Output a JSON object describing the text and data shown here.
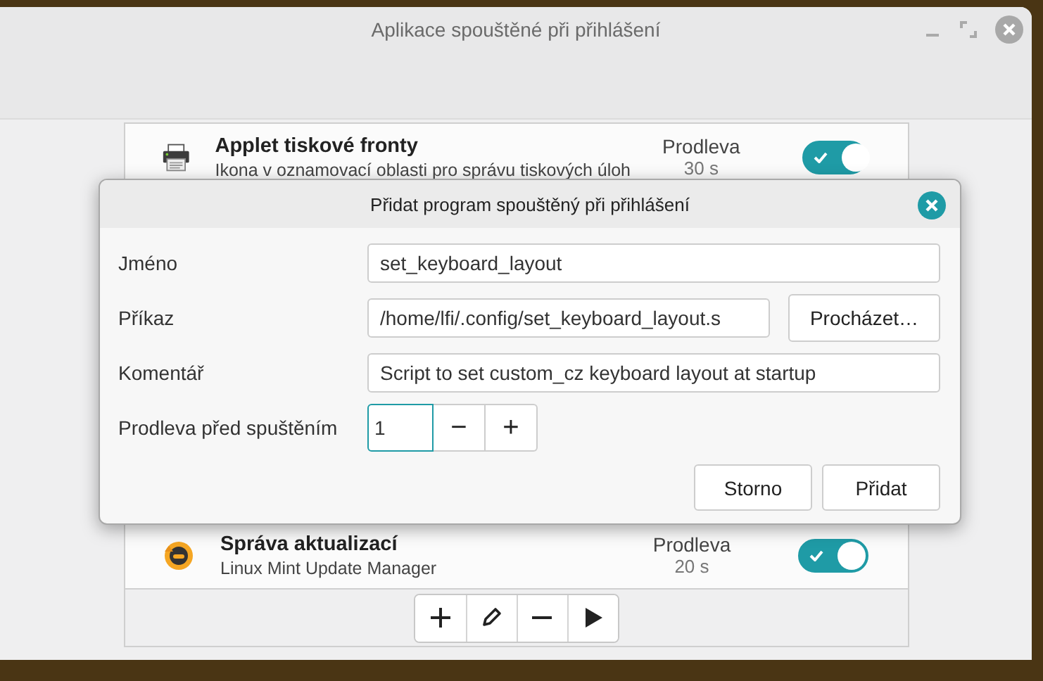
{
  "window": {
    "title": "Aplikace spouštěné při přihlášení"
  },
  "startup_list": [
    {
      "kind": "printer",
      "title": "Applet tiskové fronty",
      "subtitle": "Ikona v oznamovací oblasti pro správu tiskových úloh",
      "delay_label": "Prodleva",
      "delay": "30 s",
      "enabled": true
    },
    {
      "kind": "update",
      "title": "Správa aktualizací",
      "subtitle": "Linux Mint Update Manager",
      "delay_label": "Prodleva",
      "delay": "20 s",
      "enabled": true
    }
  ],
  "toolbar": [
    {
      "kind": "add"
    },
    {
      "kind": "edit"
    },
    {
      "kind": "remove"
    },
    {
      "kind": "run"
    }
  ],
  "dialog": {
    "title": "Přidat program spouštěný při přihlášení",
    "fields": [
      {
        "label": "Jméno",
        "value": "set_keyboard_layout"
      },
      {
        "label": "Příkaz",
        "value": "/home/lfi/.config/set_keyboard_layout.s",
        "button": "Procházet…"
      },
      {
        "label": "Komentář",
        "value": "Script to set custom_cz keyboard layout at startup"
      }
    ],
    "delay": {
      "label": "Prodleva před spuštěním",
      "value": "1",
      "focused": true,
      "minus": "−",
      "plus": "+"
    },
    "buttons": [
      "Storno",
      "Přidat"
    ]
  }
}
